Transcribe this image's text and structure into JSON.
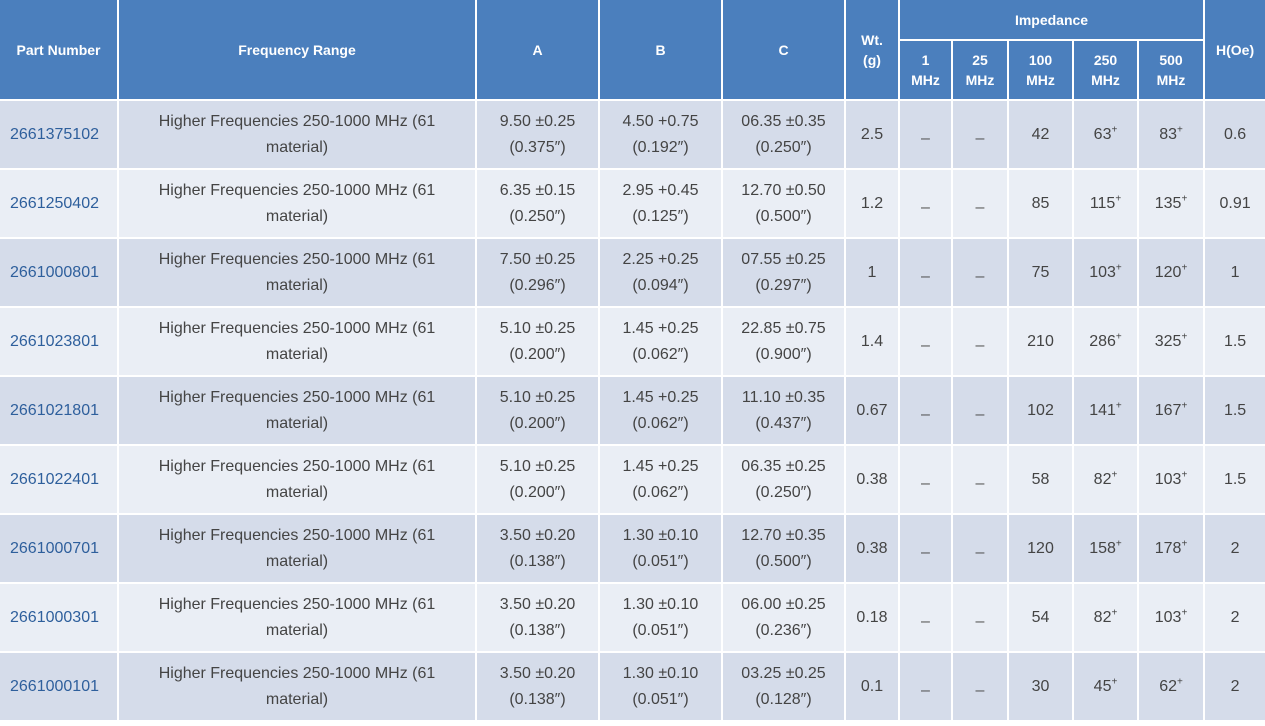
{
  "header": {
    "part_number": "Part Number",
    "frequency_range": "Frequency Range",
    "a": "A",
    "b": "B",
    "c": "C",
    "wt_line1": "Wt.",
    "wt_line2": "(g)",
    "impedance": "Impedance",
    "h_oe": "H(Oe)",
    "impedance_cols": [
      {
        "v": "1",
        "u": "MHz"
      },
      {
        "v": "25",
        "u": "MHz"
      },
      {
        "v": "100",
        "u": "MHz"
      },
      {
        "v": "250",
        "u": "MHz"
      },
      {
        "v": "500",
        "u": "MHz"
      }
    ]
  },
  "rows": [
    {
      "part": "2661375102",
      "freq_1": "Higher Frequencies 250-1000 MHz (61",
      "freq_2": "material)",
      "a_1": "9.50 ±0.25",
      "a_2": "(0.375″)",
      "b_1": "4.50 +0.75",
      "b_2": "(0.192″)",
      "c_1": "06.35 ±0.35",
      "c_2": "(0.250″)",
      "wt": "2.5",
      "z1": "–",
      "z25": "–",
      "z100": "42",
      "z250": "63",
      "z500": "83",
      "sup": "+",
      "h": "0.6"
    },
    {
      "part": "2661250402",
      "freq_1": "Higher Frequencies 250-1000 MHz (61",
      "freq_2": "material)",
      "a_1": "6.35 ±0.15",
      "a_2": "(0.250″)",
      "b_1": "2.95 +0.45",
      "b_2": "(0.125″)",
      "c_1": "12.70 ±0.50",
      "c_2": "(0.500″)",
      "wt": "1.2",
      "z1": "–",
      "z25": "–",
      "z100": "85",
      "z250": "115",
      "z500": "135",
      "sup": "+",
      "h": "0.91"
    },
    {
      "part": "2661000801",
      "freq_1": "Higher Frequencies 250-1000 MHz (61",
      "freq_2": "material)",
      "a_1": "7.50 ±0.25",
      "a_2": "(0.296″)",
      "b_1": "2.25 +0.25",
      "b_2": "(0.094″)",
      "c_1": "07.55 ±0.25",
      "c_2": "(0.297″)",
      "wt": "1",
      "z1": "–",
      "z25": "–",
      "z100": "75",
      "z250": "103",
      "z500": "120",
      "sup": "+",
      "h": "1"
    },
    {
      "part": "2661023801",
      "freq_1": "Higher Frequencies 250-1000 MHz (61",
      "freq_2": "material)",
      "a_1": "5.10 ±0.25",
      "a_2": "(0.200″)",
      "b_1": "1.45 +0.25",
      "b_2": "(0.062″)",
      "c_1": "22.85 ±0.75",
      "c_2": "(0.900″)",
      "wt": "1.4",
      "z1": "–",
      "z25": "–",
      "z100": "210",
      "z250": "286",
      "z500": "325",
      "sup": "+",
      "h": "1.5"
    },
    {
      "part": "2661021801",
      "freq_1": "Higher Frequencies 250-1000 MHz (61",
      "freq_2": "material)",
      "a_1": "5.10 ±0.25",
      "a_2": "(0.200″)",
      "b_1": "1.45 +0.25",
      "b_2": "(0.062″)",
      "c_1": "11.10 ±0.35",
      "c_2": "(0.437″)",
      "wt": "0.67",
      "z1": "–",
      "z25": "–",
      "z100": "102",
      "z250": "141",
      "z500": "167",
      "sup": "+",
      "h": "1.5"
    },
    {
      "part": "2661022401",
      "freq_1": "Higher Frequencies 250-1000 MHz (61",
      "freq_2": "material)",
      "a_1": "5.10 ±0.25",
      "a_2": "(0.200″)",
      "b_1": "1.45 +0.25",
      "b_2": "(0.062″)",
      "c_1": "06.35 ±0.25",
      "c_2": "(0.250″)",
      "wt": "0.38",
      "z1": "–",
      "z25": "–",
      "z100": "58",
      "z250": "82",
      "z500": "103",
      "sup": "+",
      "h": "1.5"
    },
    {
      "part": "2661000701",
      "freq_1": "Higher Frequencies 250-1000 MHz (61",
      "freq_2": "material)",
      "a_1": "3.50 ±0.20",
      "a_2": "(0.138″)",
      "b_1": "1.30 ±0.10",
      "b_2": "(0.051″)",
      "c_1": "12.70 ±0.35",
      "c_2": "(0.500″)",
      "wt": "0.38",
      "z1": "–",
      "z25": "–",
      "z100": "120",
      "z250": "158",
      "z500": "178",
      "sup": "+",
      "h": "2"
    },
    {
      "part": "2661000301",
      "freq_1": "Higher Frequencies 250-1000 MHz (61",
      "freq_2": "material)",
      "a_1": "3.50 ±0.20",
      "a_2": "(0.138″)",
      "b_1": "1.30 ±0.10",
      "b_2": "(0.051″)",
      "c_1": "06.00 ±0.25",
      "c_2": "(0.236″)",
      "wt": "0.18",
      "z1": "–",
      "z25": "–",
      "z100": "54",
      "z250": "82",
      "z500": "103",
      "sup": "+",
      "h": "2"
    },
    {
      "part": "2661000101",
      "freq_1": "Higher Frequencies 250-1000 MHz (61",
      "freq_2": "material)",
      "a_1": "3.50 ±0.20",
      "a_2": "(0.138″)",
      "b_1": "1.30 ±0.10",
      "b_2": "(0.051″)",
      "c_1": "03.25 ±0.25",
      "c_2": "(0.128″)",
      "wt": "0.1",
      "z1": "–",
      "z25": "–",
      "z100": "30",
      "z250": "45",
      "z500": "62",
      "sup": "+",
      "h": "2"
    }
  ],
  "colors": {
    "header_bg": "#4b7fbd",
    "row_odd": "#d5dcea",
    "row_even": "#eaeef5",
    "link": "#2e5f9c"
  }
}
